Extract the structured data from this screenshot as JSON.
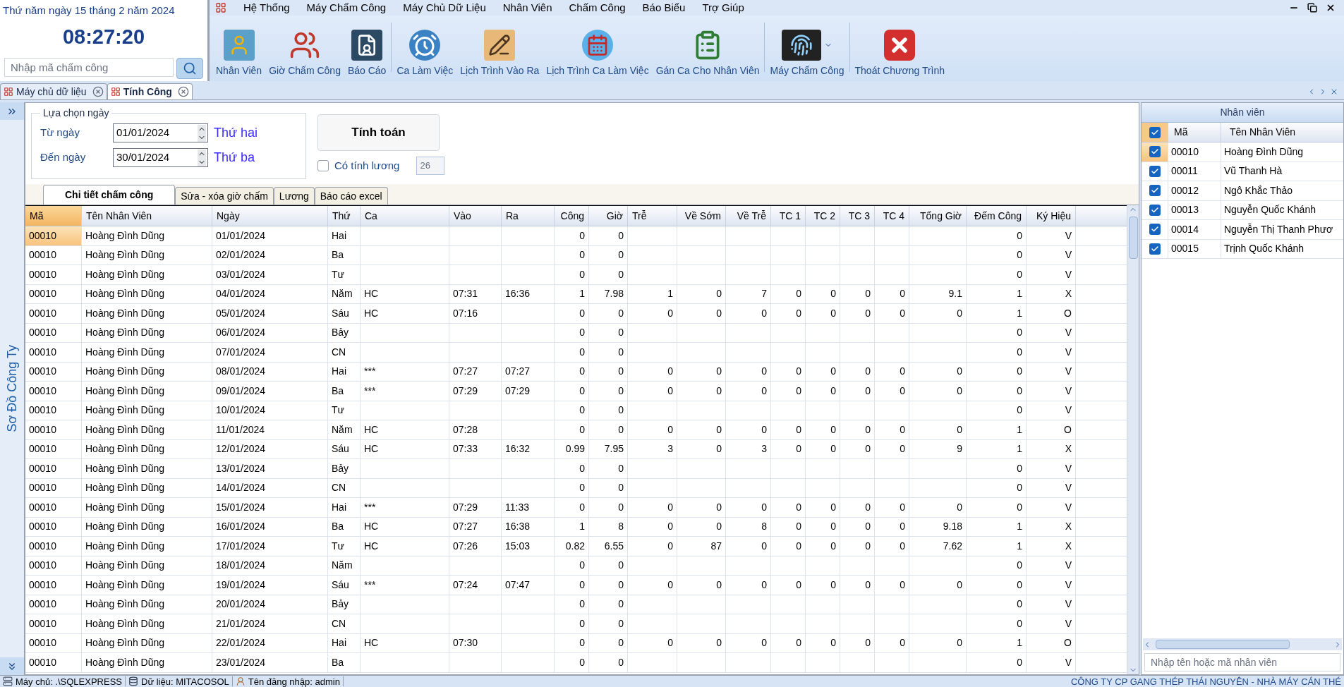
{
  "clock": {
    "date": "Thứ năm ngày 15 tháng 2 năm 2024",
    "time": "08:27:20",
    "search": {
      "placeholder": "Nhập mã chấm công"
    }
  },
  "menu": [
    "Hệ Thống",
    "Máy Chấm Công",
    "Máy Chủ Dữ Liệu",
    "Nhân Viên",
    "Chấm Công",
    "Báo Biểu",
    "Trợ Giúp"
  ],
  "ribbon_groups": [
    [
      {
        "label": "Nhân Viên",
        "kind": "user"
      },
      {
        "label": "Giờ Chấm Công",
        "kind": "people"
      },
      {
        "label": "Báo Cáo",
        "kind": "report"
      }
    ],
    [
      {
        "label": "Ca Làm Việc",
        "kind": "alarm"
      },
      {
        "label": "Lịch Trình Vào Ra",
        "kind": "pencil"
      },
      {
        "label": "Lịch Trình Ca Làm Việc",
        "kind": "calendar"
      },
      {
        "label": "Gán Ca Cho Nhân Viên",
        "kind": "clipboard"
      }
    ],
    [
      {
        "label": "Máy Chấm Công",
        "kind": "device"
      }
    ],
    [
      {
        "label": "Thoát Chương Trình",
        "kind": "exit"
      }
    ]
  ],
  "doc_tabs": [
    {
      "label": "Máy chủ dữ liệu",
      "selected": false
    },
    {
      "label": "Tính Công",
      "selected": true
    }
  ],
  "sidebar": {
    "label": "Sơ Đồ Công Ty"
  },
  "filter": {
    "legend": "Lựa chọn ngày",
    "from_label": "Từ ngày",
    "from_value": "01/01/2024",
    "from_day": "Thứ hai",
    "to_label": "Đến ngày",
    "to_value": "30/01/2024",
    "to_day": "Thứ ba",
    "compute_button": "Tính toán",
    "salary_label": "Có tính lương",
    "salary_checked": false,
    "salary_days": "26"
  },
  "view_tabs": [
    {
      "label": "Chi tiết chấm công",
      "selected": true
    },
    {
      "label": "Sửa - xóa giờ chấm",
      "selected": false
    },
    {
      "label": "Lương",
      "selected": false
    },
    {
      "label": "Báo cáo excel",
      "selected": false
    }
  ],
  "table": {
    "columns": [
      "Mã",
      "Tên Nhân Viên",
      "Ngày",
      "Thứ",
      "Ca",
      "Vào",
      "Ra",
      "Công",
      "Giờ",
      "Trễ",
      "Về Sớm",
      "Về Trễ",
      "TC 1",
      "TC 2",
      "TC 3",
      "TC 4",
      "Tổng Giờ",
      "Đếm Công",
      "Ký Hiệu"
    ],
    "rows": [
      {
        "selected": true,
        "cells": [
          "00010",
          "Hoàng Đình Dũng",
          "01/01/2024",
          "Hai",
          null,
          null,
          null,
          "0",
          "0",
          null,
          null,
          null,
          null,
          null,
          null,
          null,
          null,
          "0",
          "V"
        ]
      },
      {
        "selected": false,
        "cells": [
          "00010",
          "Hoàng Đình Dũng",
          "02/01/2024",
          "Ba",
          null,
          null,
          null,
          "0",
          "0",
          null,
          null,
          null,
          null,
          null,
          null,
          null,
          null,
          "0",
          "V"
        ]
      },
      {
        "selected": false,
        "cells": [
          "00010",
          "Hoàng Đình Dũng",
          "03/01/2024",
          "Tư",
          null,
          null,
          null,
          "0",
          "0",
          null,
          null,
          null,
          null,
          null,
          null,
          null,
          null,
          "0",
          "V"
        ]
      },
      {
        "selected": false,
        "cells": [
          "00010",
          "Hoàng Đình Dũng",
          "04/01/2024",
          "Năm",
          "HC",
          "07:31",
          "16:36",
          "1",
          "7.98",
          "1",
          "0",
          "7",
          "0",
          "0",
          "0",
          "0",
          "9.1",
          "1",
          "X"
        ]
      },
      {
        "selected": false,
        "cells": [
          "00010",
          "Hoàng Đình Dũng",
          "05/01/2024",
          "Sáu",
          "HC",
          "07:16",
          null,
          "0",
          "0",
          "0",
          "0",
          "0",
          "0",
          "0",
          "0",
          "0",
          "0",
          "1",
          "O"
        ]
      },
      {
        "selected": false,
        "cells": [
          "00010",
          "Hoàng Đình Dũng",
          "06/01/2024",
          "Bảy",
          null,
          null,
          null,
          "0",
          "0",
          null,
          null,
          null,
          null,
          null,
          null,
          null,
          null,
          "0",
          "V"
        ]
      },
      {
        "selected": false,
        "cells": [
          "00010",
          "Hoàng Đình Dũng",
          "07/01/2024",
          "CN",
          null,
          null,
          null,
          "0",
          "0",
          null,
          null,
          null,
          null,
          null,
          null,
          null,
          null,
          "0",
          "V"
        ]
      },
      {
        "selected": false,
        "cells": [
          "00010",
          "Hoàng Đình Dũng",
          "08/01/2024",
          "Hai",
          "***",
          "07:27",
          "07:27",
          "0",
          "0",
          "0",
          "0",
          "0",
          "0",
          "0",
          "0",
          "0",
          "0",
          "0",
          "V"
        ]
      },
      {
        "selected": false,
        "cells": [
          "00010",
          "Hoàng Đình Dũng",
          "09/01/2024",
          "Ba",
          "***",
          "07:29",
          "07:29",
          "0",
          "0",
          "0",
          "0",
          "0",
          "0",
          "0",
          "0",
          "0",
          "0",
          "0",
          "V"
        ]
      },
      {
        "selected": false,
        "cells": [
          "00010",
          "Hoàng Đình Dũng",
          "10/01/2024",
          "Tư",
          null,
          null,
          null,
          "0",
          "0",
          null,
          null,
          null,
          null,
          null,
          null,
          null,
          null,
          "0",
          "V"
        ]
      },
      {
        "selected": false,
        "cells": [
          "00010",
          "Hoàng Đình Dũng",
          "11/01/2024",
          "Năm",
          "HC",
          "07:28",
          null,
          "0",
          "0",
          "0",
          "0",
          "0",
          "0",
          "0",
          "0",
          "0",
          "0",
          "1",
          "O"
        ]
      },
      {
        "selected": false,
        "cells": [
          "00010",
          "Hoàng Đình Dũng",
          "12/01/2024",
          "Sáu",
          "HC",
          "07:33",
          "16:32",
          "0.99",
          "7.95",
          "3",
          "0",
          "3",
          "0",
          "0",
          "0",
          "0",
          "9",
          "1",
          "X"
        ]
      },
      {
        "selected": false,
        "cells": [
          "00010",
          "Hoàng Đình Dũng",
          "13/01/2024",
          "Bảy",
          null,
          null,
          null,
          "0",
          "0",
          null,
          null,
          null,
          null,
          null,
          null,
          null,
          null,
          "0",
          "V"
        ]
      },
      {
        "selected": false,
        "cells": [
          "00010",
          "Hoàng Đình Dũng",
          "14/01/2024",
          "CN",
          null,
          null,
          null,
          "0",
          "0",
          null,
          null,
          null,
          null,
          null,
          null,
          null,
          null,
          "0",
          "V"
        ]
      },
      {
        "selected": false,
        "cells": [
          "00010",
          "Hoàng Đình Dũng",
          "15/01/2024",
          "Hai",
          "***",
          "07:29",
          "11:33",
          "0",
          "0",
          "0",
          "0",
          "0",
          "0",
          "0",
          "0",
          "0",
          "0",
          "0",
          "V"
        ]
      },
      {
        "selected": false,
        "cells": [
          "00010",
          "Hoàng Đình Dũng",
          "16/01/2024",
          "Ba",
          "HC",
          "07:27",
          "16:38",
          "1",
          "8",
          "0",
          "0",
          "8",
          "0",
          "0",
          "0",
          "0",
          "9.18",
          "1",
          "X"
        ]
      },
      {
        "selected": false,
        "cells": [
          "00010",
          "Hoàng Đình Dũng",
          "17/01/2024",
          "Tư",
          "HC",
          "07:26",
          "15:03",
          "0.82",
          "6.55",
          "0",
          "87",
          "0",
          "0",
          "0",
          "0",
          "0",
          "7.62",
          "1",
          "X"
        ]
      },
      {
        "selected": false,
        "cells": [
          "00010",
          "Hoàng Đình Dũng",
          "18/01/2024",
          "Năm",
          null,
          null,
          null,
          "0",
          "0",
          null,
          null,
          null,
          null,
          null,
          null,
          null,
          null,
          "0",
          "V"
        ]
      },
      {
        "selected": false,
        "cells": [
          "00010",
          "Hoàng Đình Dũng",
          "19/01/2024",
          "Sáu",
          "***",
          "07:24",
          "07:47",
          "0",
          "0",
          "0",
          "0",
          "0",
          "0",
          "0",
          "0",
          "0",
          "0",
          "0",
          "V"
        ]
      },
      {
        "selected": false,
        "cells": [
          "00010",
          "Hoàng Đình Dũng",
          "20/01/2024",
          "Bảy",
          null,
          null,
          null,
          "0",
          "0",
          null,
          null,
          null,
          null,
          null,
          null,
          null,
          null,
          "0",
          "V"
        ]
      },
      {
        "selected": false,
        "cells": [
          "00010",
          "Hoàng Đình Dũng",
          "21/01/2024",
          "CN",
          null,
          null,
          null,
          "0",
          "0",
          null,
          null,
          null,
          null,
          null,
          null,
          null,
          null,
          "0",
          "V"
        ]
      },
      {
        "selected": false,
        "cells": [
          "00010",
          "Hoàng Đình Dũng",
          "22/01/2024",
          "Hai",
          "HC",
          "07:30",
          null,
          "0",
          "0",
          "0",
          "0",
          "0",
          "0",
          "0",
          "0",
          "0",
          "0",
          "1",
          "O"
        ]
      },
      {
        "selected": false,
        "cells": [
          "00010",
          "Hoàng Đình Dũng",
          "23/01/2024",
          "Ba",
          null,
          null,
          null,
          "0",
          "0",
          null,
          null,
          null,
          null,
          null,
          null,
          null,
          null,
          "0",
          "V"
        ]
      }
    ]
  },
  "employees": {
    "title": "Nhân viên",
    "all_checked": true,
    "columns": [
      "Mã",
      "Tên Nhân Viên"
    ],
    "rows": [
      {
        "code": "00010",
        "name": "Hoàng Đình Dũng",
        "checked": true,
        "selected": true
      },
      {
        "code": "00011",
        "name": "Vũ Thanh Hà",
        "checked": true,
        "selected": false
      },
      {
        "code": "00012",
        "name": "Ngô Khắc Thảo",
        "checked": true,
        "selected": false
      },
      {
        "code": "00013",
        "name": "Nguyễn Quốc Khánh",
        "checked": true,
        "selected": false
      },
      {
        "code": "00014",
        "name": "Nguyễn Thị Thanh Phươ",
        "checked": true,
        "selected": false
      },
      {
        "code": "00015",
        "name": "Trịnh Quốc Khánh",
        "checked": true,
        "selected": false
      }
    ],
    "search": {
      "placeholder": "Nhập tên hoặc mã nhân viên"
    }
  },
  "status_bar": [
    {
      "kind": "server",
      "text": "Máy chủ: .\\SQLEXPRESS"
    },
    {
      "kind": "database",
      "text": "Dữ liệu: MITACOSOL"
    },
    {
      "kind": "user",
      "text": "Tên đăng nhập: admin"
    },
    {
      "kind": "company",
      "text": "CÔNG TY CP GANG THÉP THÁI NGUYÊN - NHÀ MÁY CÁN THÉ"
    }
  ]
}
